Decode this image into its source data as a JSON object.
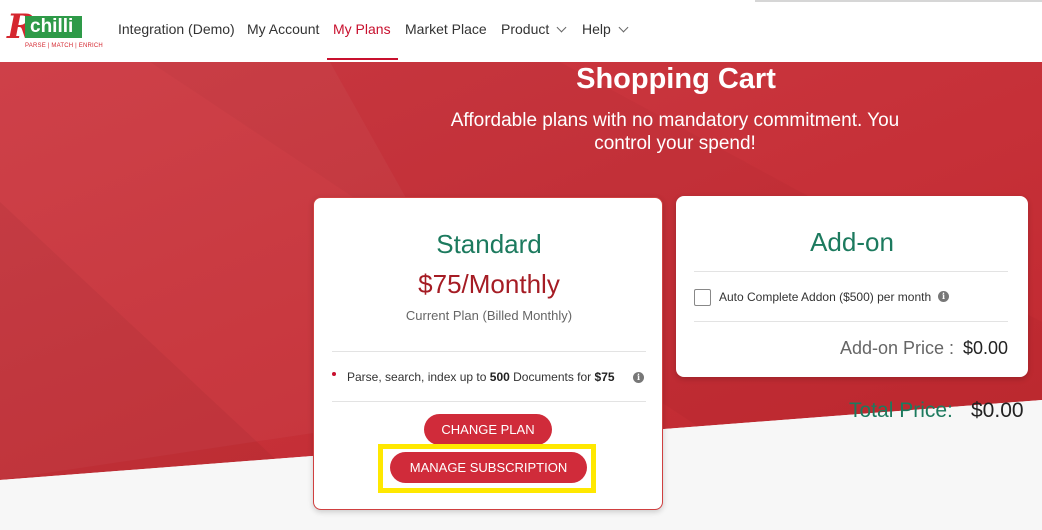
{
  "brand": {
    "logo_mark": "R",
    "logo_word": "chilli",
    "logo_tagline": "PARSE | MATCH | ENRICH"
  },
  "nav": {
    "items": [
      {
        "label": "Integration (Demo)"
      },
      {
        "label": "My Account"
      },
      {
        "label": "My Plans",
        "active": true
      },
      {
        "label": "Market Place"
      },
      {
        "label": "Product",
        "dropdown": true
      },
      {
        "label": "Help",
        "dropdown": true
      }
    ]
  },
  "hero": {
    "title": "Shopping Cart",
    "subtitle": "Affordable plans with no mandatory commitment. You control your spend!"
  },
  "standard_plan": {
    "name": "Standard",
    "price": "$75/Monthly",
    "current": "Current Plan (Billed Monthly)",
    "feature_prefix": "Parse, search, index up to",
    "feature_count": "500",
    "feature_mid": "Documents for",
    "feature_price": "$75",
    "change_button": "CHANGE PLAN",
    "manage_button": "MANAGE SUBSCRIPTION"
  },
  "addon": {
    "title": "Add-on",
    "checkbox_label": "Auto Complete Addon ($500) per month",
    "checked": false,
    "price_label": "Add-on Price :",
    "price_value": "$0.00"
  },
  "total": {
    "label": "Total Price:",
    "value": "$0.00"
  },
  "colors": {
    "brand_red": "#c8102e",
    "hero_red": "#c9303a",
    "plan_green": "#1c7a5e",
    "price_red": "#a51c24",
    "button_red": "#d02b3a",
    "highlight_yellow": "#ffe800"
  },
  "icons": [
    "info-icon",
    "chevron-down-icon"
  ]
}
